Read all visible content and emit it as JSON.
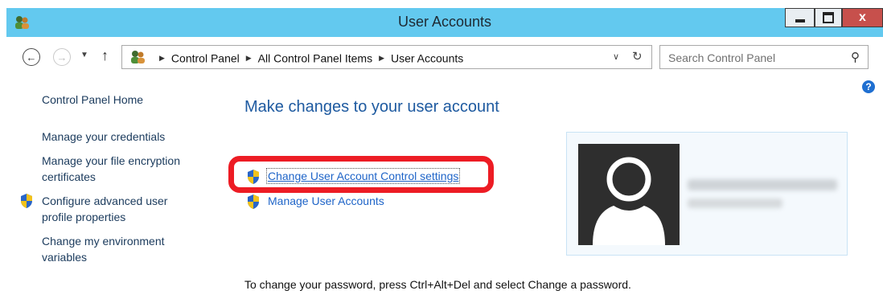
{
  "window": {
    "title": "User Accounts",
    "close_label": "x"
  },
  "address": {
    "crumbs": [
      "Control Panel",
      "All Control Panel Items",
      "User Accounts"
    ]
  },
  "search": {
    "placeholder": "Search Control Panel"
  },
  "help": {
    "label": "?"
  },
  "sidebar": {
    "items": [
      {
        "label": "Control Panel Home"
      },
      {
        "label": "Manage your credentials"
      },
      {
        "label": "Manage your file encryption certificates"
      },
      {
        "label": "Configure advanced user profile properties"
      },
      {
        "label": "Change my environment variables"
      }
    ]
  },
  "main": {
    "title": "Make changes to your user account",
    "links": [
      {
        "label": "Change User Account Control settings"
      },
      {
        "label": "Manage User Accounts"
      }
    ],
    "footer": "To change your password, press Ctrl+Alt+Del and select Change a password."
  },
  "colors": {
    "titlebar": "#63c9ef",
    "close_button": "#c7504c",
    "highlight": "#ed1c24",
    "link": "#1e64c8"
  },
  "icons": [
    "users-icon",
    "back-arrow-icon",
    "forward-arrow-icon",
    "up-arrow-icon",
    "refresh-icon",
    "search-icon",
    "shield-icon",
    "help-icon",
    "user-avatar-icon"
  ]
}
